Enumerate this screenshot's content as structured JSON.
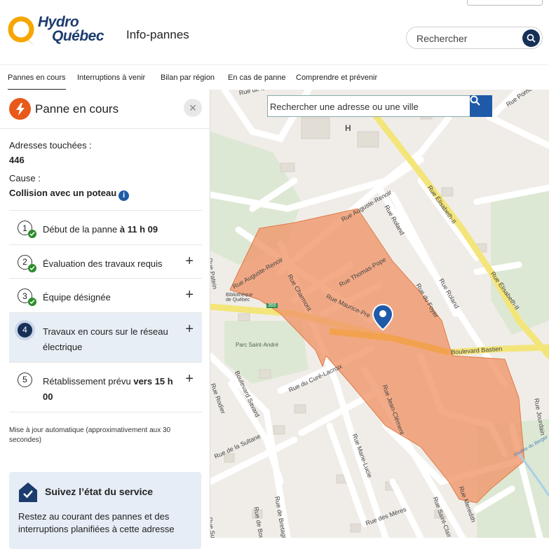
{
  "header": {
    "brand_line1": "Hydro",
    "brand_line2": "Québec",
    "app_title": "Info-pannes",
    "search_placeholder": "Rechercher",
    "colors": {
      "brand_orange": "#f7a600",
      "brand_navy": "#1c3c6e",
      "accent_blue": "#1e5aa8"
    }
  },
  "nav": {
    "items": [
      {
        "label": "Pannes en cours",
        "active": true
      },
      {
        "label": "Interruptions à venir"
      },
      {
        "label": "Bilan par région"
      },
      {
        "label": "En cas de panne"
      },
      {
        "label": "Comprendre et prévenir"
      }
    ]
  },
  "panel": {
    "title": "Panne en cours",
    "close_icon": "close-icon",
    "addresses_label": "Adresses touchées :",
    "addresses_value": "446",
    "cause_label": "Cause :",
    "cause_value": "Collision avec un poteau",
    "steps": [
      {
        "num": "1",
        "text": "Début de la panne ",
        "bold": "à 11 h 09",
        "done": true
      },
      {
        "num": "2",
        "text": "Évaluation des travaux requis",
        "done": true
      },
      {
        "num": "3",
        "text": "Équipe désignée",
        "done": true
      },
      {
        "num": "4",
        "text": "Travaux en cours sur le réseau électrique",
        "active": true
      },
      {
        "num": "5",
        "text": "Rétablissement prévu ",
        "bold": "vers 15 h 00"
      }
    ],
    "update_note": "Mise à jour automatique (approximativement aux 30 secondes)",
    "card": {
      "title": "Suivez l’état du service",
      "body": "Restez au courant des pannes et des interruptions planifiées à cette adresse"
    }
  },
  "map": {
    "search_placeholder": "Rechercher une adresse ou une ville",
    "outage_color": "#f0966a",
    "hospital_symbol": "H",
    "route_number": "369",
    "labels": {
      "rue_de_la_so": "Rue de la So",
      "rue_auguste_renoir_top": "Rue Auguste-Renoir",
      "rue_auguste_renoir_left": "Rue Auguste-Renoir",
      "rue_roland": "Rue Roland",
      "rue_elisabeth_ii_a": "Rue Élisabeth-II",
      "rue_elisabeth_ii_b": "Rue Élisabeth-II",
      "rue_thomas_pope": "Rue Thomas-Pope",
      "rue_maurice_pre": "Rue Maurice-Pre",
      "rue_charmont": "Rue Charmont",
      "rue_du_foyer": "Rue du Foyer",
      "rue_roland_b": "Rue Roland",
      "bibliotheque": "Bibliothèque de Québec",
      "boulevard_bastien": "Boulevard Bastien",
      "parc_saint_andre": "Parc Saint-André",
      "rue_du_cure_lacroix": "Rue du Curé-Lacroix",
      "rue_jean_clement": "Rue Jean-Clément",
      "rue_rodier": "Rue Rodier",
      "boulevard_savard": "Boulevard Savard",
      "rue_de_la_sultane": "Rue de la Sultane",
      "rue_marie_lucie": "Rue Marie-Lucie",
      "rue_de_bretagne": "Rue de Bretagne",
      "rue_de_boulogne": "Rue de Boulogne",
      "rue_des_meres": "Rue des Mères",
      "rue_saint_clair": "Rue Saint-Clair",
      "rue_meredith": "Rue Meredith",
      "riviere_du_berger": "Rivière du Berger",
      "rue_jourdain": "Rue Jourdain",
      "rue_pomerol": "Rue Pomerol",
      "rue_pattin": "Rue Patein",
      "rue_de_super": "Rue Super"
    }
  }
}
